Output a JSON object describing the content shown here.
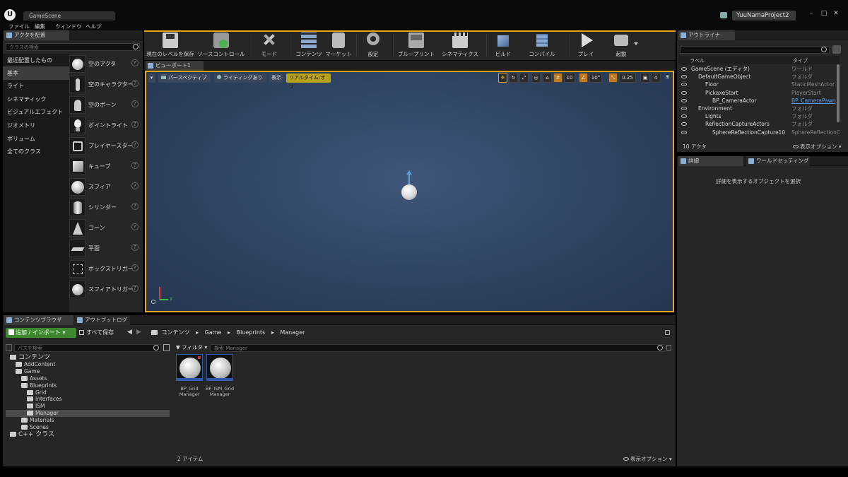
{
  "window": {
    "tab_title": "GameScene",
    "project_name": "YuuNamaProject2"
  },
  "menu": [
    "ファイル",
    "編集",
    "ウィンドウ",
    "ヘルプ"
  ],
  "place_actors": {
    "tab_label": "アクタを配置",
    "search_placeholder": "クラスの検索",
    "categories": [
      "最近配置したもの",
      "基本",
      "ライト",
      "シネマティック",
      "ビジュアルエフェクト",
      "ジオメトリ",
      "ボリューム",
      "全てのクラス"
    ],
    "selected_category": "基本",
    "items": [
      {
        "label": "空のアクタ",
        "icon": "sphere-icon"
      },
      {
        "label": "空のキャラクター",
        "icon": "character-icon"
      },
      {
        "label": "空のポーン",
        "icon": "pawn-icon"
      },
      {
        "label": "ポイントライト",
        "icon": "lightbulb-icon"
      },
      {
        "label": "プレイヤースター",
        "icon": "player-start-icon"
      },
      {
        "label": "キューブ",
        "icon": "cube-icon"
      },
      {
        "label": "スフィア",
        "icon": "sphere-icon"
      },
      {
        "label": "シリンダー",
        "icon": "cylinder-icon"
      },
      {
        "label": "コーン",
        "icon": "cone-icon"
      },
      {
        "label": "平面",
        "icon": "plane-icon"
      },
      {
        "label": "ボックストリガー",
        "icon": "box-trigger-icon"
      },
      {
        "label": "スフィアトリガー",
        "icon": "sphere-trigger-icon"
      }
    ],
    "help_glyph": "?"
  },
  "toolbar": {
    "buttons": [
      {
        "label": "現在のレベルを保存",
        "icon": "save-icon"
      },
      {
        "label": "ソースコントロール",
        "icon": "source-control-icon"
      },
      {
        "label": "モード",
        "icon": "modes-icon"
      },
      {
        "label": "コンテンツ",
        "icon": "content-icon"
      },
      {
        "label": "マーケット",
        "icon": "marketplace-icon"
      },
      {
        "label": "設定",
        "icon": "settings-icon"
      },
      {
        "label": "ブループリント",
        "icon": "blueprint-icon"
      },
      {
        "label": "シネマティクス",
        "icon": "cinematics-icon"
      },
      {
        "label": "ビルド",
        "icon": "build-icon"
      },
      {
        "label": "コンパイル",
        "icon": "compile-icon"
      },
      {
        "label": "プレイ",
        "icon": "play-icon"
      },
      {
        "label": "起動",
        "icon": "launch-icon"
      }
    ]
  },
  "viewport": {
    "tab_label": "ビューポート1",
    "perspective": "パースペクティブ",
    "lighting": "ライティングあり",
    "show": "表示",
    "realtime": "リアルタイム:オフ",
    "grid_snap": "10",
    "rotation_snap": "10°",
    "scale_snap": "0.25",
    "camera_speed": "4",
    "axis_x": "x",
    "axis_y": "y"
  },
  "outliner": {
    "tab_label": "アウトライナ",
    "search_placeholder": "",
    "col_label": "ラベル",
    "col_type": "タイプ",
    "rows": [
      {
        "name": "GameScene (エディタ)",
        "type": "ワールド",
        "indent": 0
      },
      {
        "name": "DefaultGameObject",
        "type": "フォルダ",
        "indent": 1
      },
      {
        "name": "Floor",
        "type": "StaticMeshActor",
        "indent": 2
      },
      {
        "name": "PickaxeStart",
        "type": "PlayerStart",
        "indent": 2
      },
      {
        "name": "BP_CameraActor",
        "type": "BP_CameraPawn",
        "indent": 3
      },
      {
        "name": "Environment",
        "type": "フォルダ",
        "indent": 1
      },
      {
        "name": "Lights",
        "type": "フォルダ",
        "indent": 2
      },
      {
        "name": "ReflectionCaptureActors",
        "type": "フォルダ",
        "indent": 2
      },
      {
        "name": "SphereReflectionCapture10",
        "type": "SphereReflectionC",
        "indent": 3
      }
    ],
    "actor_count": "10 アクタ",
    "view_options": "表示オプション"
  },
  "details": {
    "tab_label": "詳細",
    "tab2_label": "ワールドセッティング",
    "message": "詳細を表示するオブジェクトを選択"
  },
  "content_browser": {
    "tab_label": "コンテンツブラウザ",
    "tab2_label": "アウトプットログ",
    "add_import": "追加 / インポート",
    "save_all": "すべて保存",
    "breadcrumb": [
      "コンテンツ",
      "Game",
      "Blueprints",
      "Manager"
    ],
    "path_search_placeholder": "パスを検索",
    "filter_label": "フィルタ",
    "search_placeholder": "検索 Manager",
    "tree": [
      {
        "name": "コンテンツ",
        "indent": 0,
        "big": true
      },
      {
        "name": "AddContent",
        "indent": 1
      },
      {
        "name": "Game",
        "indent": 1
      },
      {
        "name": "Assets",
        "indent": 2
      },
      {
        "name": "Blueprints",
        "indent": 2
      },
      {
        "name": "Grid",
        "indent": 3
      },
      {
        "name": "Interfaces",
        "indent": 3
      },
      {
        "name": "ISM",
        "indent": 3
      },
      {
        "name": "Manager",
        "indent": 3,
        "selected": true
      },
      {
        "name": "Materials",
        "indent": 2
      },
      {
        "name": "Scenes",
        "indent": 2
      },
      {
        "name": "C++ クラス",
        "indent": 0,
        "big": true
      }
    ],
    "assets": [
      {
        "name": "BP_Grid Manager"
      },
      {
        "name": "BP_ISM_Grid Manager"
      }
    ],
    "item_count": "2 アイテム",
    "view_options": "表示オプション"
  },
  "colors": {
    "accent_orange": "#e8a317",
    "play_green": "#4caf50",
    "selection_blue": "#2e5aa8"
  }
}
